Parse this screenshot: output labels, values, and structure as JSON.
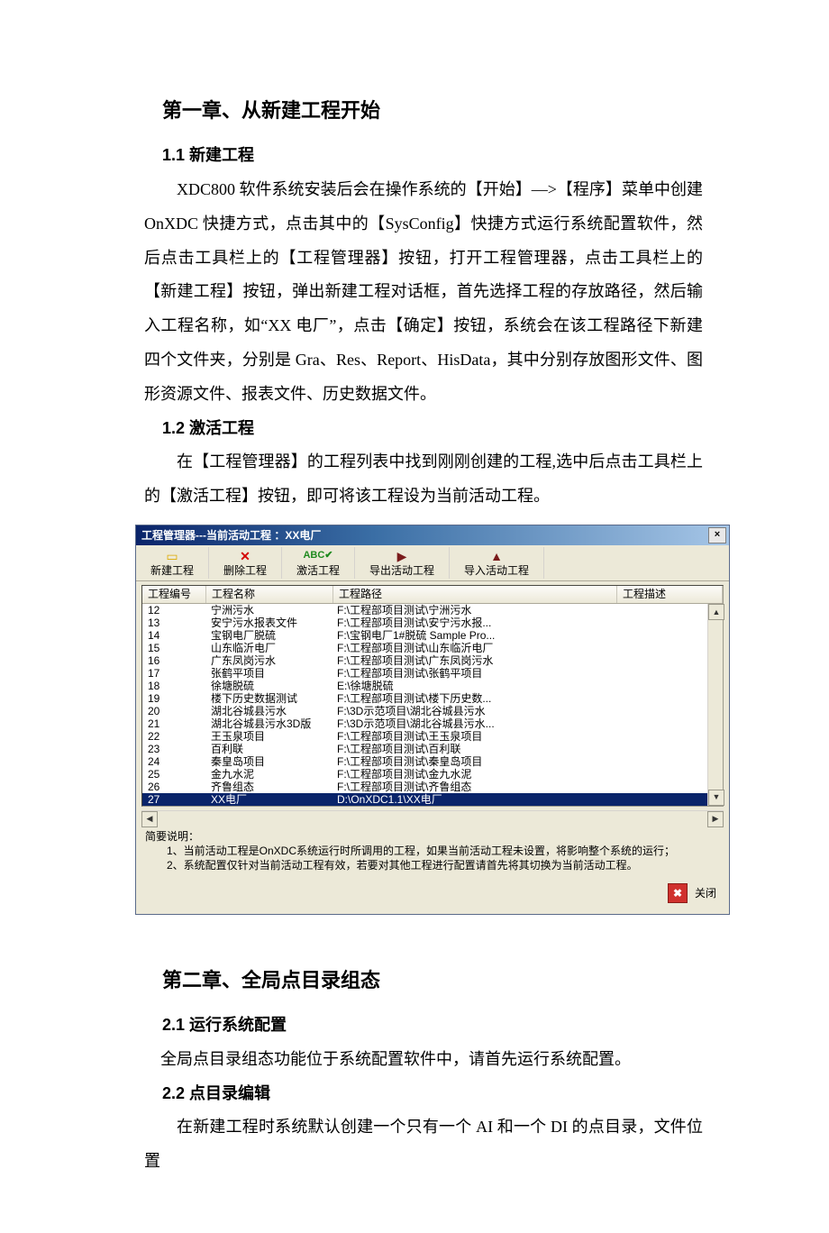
{
  "chapter1": {
    "title": "第一章、从新建工程开始",
    "sec1_title": "1.1 新建工程",
    "sec1_body": "XDC800 软件系统安装后会在操作系统的【开始】—>【程序】菜单中创建 OnXDC 快捷方式，点击其中的【SysConfig】快捷方式运行系统配置软件，然后点击工具栏上的【工程管理器】按钮，打开工程管理器，点击工具栏上的【新建工程】按钮，弹出新建工程对话框，首先选择工程的存放路径，然后输入工程名称，如“XX 电厂”，点击【确定】按钮，系统会在该工程路径下新建四个文件夹，分别是 Gra、Res、Report、HisData，其中分别存放图形文件、图形资源文件、报表文件、历史数据文件。",
    "sec2_title": "1.2 激活工程",
    "sec2_body": "在【工程管理器】的工程列表中找到刚刚创建的工程,选中后点击工具栏上的【激活工程】按钮，即可将该工程设为当前活动工程。"
  },
  "dialog": {
    "title": "工程管理器---当前活动工程 ：XX电厂",
    "toolbar": {
      "new": "新建工程",
      "delete": "删除工程",
      "activate": "激活工程",
      "export": "导出活动工程",
      "import": "导入活动工程"
    },
    "columns": {
      "id": "工程编号",
      "name": "工程名称",
      "path": "工程路径",
      "desc": "工程描述"
    },
    "rows": [
      {
        "id": "12",
        "name": "宁洲污水",
        "path": "F:\\工程部项目测试\\宁洲污水",
        "desc": ""
      },
      {
        "id": "13",
        "name": "安宁污水报表文件",
        "path": "F:\\工程部项目测试\\安宁污水报...",
        "desc": ""
      },
      {
        "id": "14",
        "name": "宝钢电厂脱硫",
        "path": "F:\\宝钢电厂1#脱硫 Sample Pro...",
        "desc": ""
      },
      {
        "id": "15",
        "name": "山东临沂电厂",
        "path": "F:\\工程部项目测试\\山东临沂电厂",
        "desc": ""
      },
      {
        "id": "16",
        "name": "广东凤岗污水",
        "path": "F:\\工程部项目测试\\广东凤岗污水",
        "desc": ""
      },
      {
        "id": "17",
        "name": "张鹤平项目",
        "path": "F:\\工程部项目测试\\张鹤平项目",
        "desc": ""
      },
      {
        "id": "18",
        "name": "徐塘脱硫",
        "path": "E:\\徐塘脱硫",
        "desc": ""
      },
      {
        "id": "19",
        "name": "楼下历史数据测试",
        "path": "F:\\工程部项目测试\\楼下历史数...",
        "desc": ""
      },
      {
        "id": "20",
        "name": "湖北谷城县污水",
        "path": "F:\\3D示范项目\\湖北谷城县污水",
        "desc": ""
      },
      {
        "id": "21",
        "name": "湖北谷城县污水3D版",
        "path": "F:\\3D示范项目\\湖北谷城县污水...",
        "desc": ""
      },
      {
        "id": "22",
        "name": "王玉泉项目",
        "path": "F:\\工程部项目测试\\王玉泉项目",
        "desc": ""
      },
      {
        "id": "23",
        "name": "百利联",
        "path": "F:\\工程部项目测试\\百利联",
        "desc": ""
      },
      {
        "id": "24",
        "name": "秦皇岛项目",
        "path": "F:\\工程部项目测试\\秦皇岛项目",
        "desc": ""
      },
      {
        "id": "25",
        "name": "金九水泥",
        "path": "F:\\工程部项目测试\\金九水泥",
        "desc": ""
      },
      {
        "id": "26",
        "name": "齐鲁组态",
        "path": "F:\\工程部项目测试\\齐鲁组态",
        "desc": ""
      },
      {
        "id": "27",
        "name": "XX电厂",
        "path": "D:\\OnXDC1.1\\XX电厂",
        "desc": "",
        "selected": true
      }
    ],
    "explain_title": "简要说明：",
    "explain_line1": "1、当前活动工程是OnXDC系统运行时所调用的工程，如果当前活动工程未设置，将影响整个系统的运行；",
    "explain_line2": "2、系统配置仅针对当前活动工程有效，若要对其他工程进行配置请首先将其切换为当前活动工程。",
    "close_label": "关闭"
  },
  "chapter2": {
    "title": "第二章、全局点目录组态",
    "sec1_title": "2.1 运行系统配置",
    "sec1_body": "全局点目录组态功能位于系统配置软件中，请首先运行系统配置。",
    "sec2_title": "2.2 点目录编辑",
    "sec2_body": "在新建工程时系统默认创建一个只有一个 AI 和一个 DI 的点目录，文件位置"
  }
}
